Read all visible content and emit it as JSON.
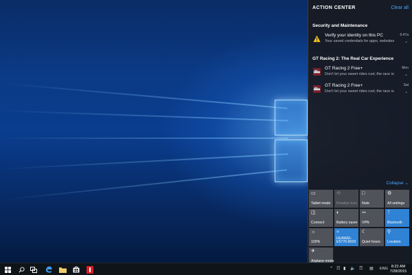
{
  "action_center": {
    "title": "ACTION CENTER",
    "clear_all": "Clear all",
    "groups": [
      {
        "title": "Security and Maintenance",
        "notifications": [
          {
            "title": "Verify your identity on this PC",
            "body": "Your saved credentials for apps, websites",
            "time": "6:47a",
            "icon": "warning-icon"
          }
        ]
      },
      {
        "title": "GT Racing 2: The Real Car Experience",
        "notifications": [
          {
            "title": "GT Racing 2 Free+",
            "body": "Don't let your sweet rides rust; the race is",
            "time": "Mon",
            "icon": "gt-racing-app-icon"
          },
          {
            "title": "GT Racing 2 Free+",
            "body": "Don't let your sweet rides rust; the race is",
            "time": "Sat",
            "icon": "gt-racing-app-icon"
          }
        ]
      }
    ],
    "collapse_label": "Collapse",
    "quick_actions": [
      {
        "label": "Tablet mode",
        "icon": "tablet-mode-icon",
        "state": "off"
      },
      {
        "label": "Rotation lock",
        "icon": "rotation-lock-icon",
        "state": "disabled"
      },
      {
        "label": "Note",
        "icon": "note-icon",
        "state": "off"
      },
      {
        "label": "All settings",
        "icon": "gear-icon",
        "state": "off"
      },
      {
        "label": "Connect",
        "icon": "connect-icon",
        "state": "off"
      },
      {
        "label": "Battery saver",
        "icon": "battery-saver-icon",
        "state": "off"
      },
      {
        "label": "VPN",
        "icon": "vpn-icon",
        "state": "off"
      },
      {
        "label": "Bluetooth",
        "icon": "bluetooth-icon",
        "state": "on"
      },
      {
        "label": "100%",
        "icon": "brightness-icon",
        "state": "off"
      },
      {
        "label": "HUAWEI-E5776-8029",
        "label_line1": "HUAWEI-",
        "label_line2": "E5776-8029",
        "icon": "wifi-icon",
        "state": "on"
      },
      {
        "label": "Quiet hours",
        "icon": "moon-icon",
        "state": "off"
      },
      {
        "label": "Location",
        "icon": "location-icon",
        "state": "on"
      },
      {
        "label": "Airplane mode",
        "icon": "airplane-icon",
        "state": "off"
      }
    ]
  },
  "taskbar": {
    "items": [
      "start-icon",
      "search-icon",
      "edge-icon",
      "file-explorer-icon",
      "store-icon",
      "gt-racing-taskbar-icon"
    ],
    "language": "ENG",
    "time": "8:22 AM",
    "date": "7/28/2015"
  },
  "colors": {
    "accent": "#2f82d4",
    "link": "#4ca6ff",
    "tile_off": "#50535a",
    "panel_bg": "#181a20",
    "taskbar_bg": "#0f1419"
  }
}
